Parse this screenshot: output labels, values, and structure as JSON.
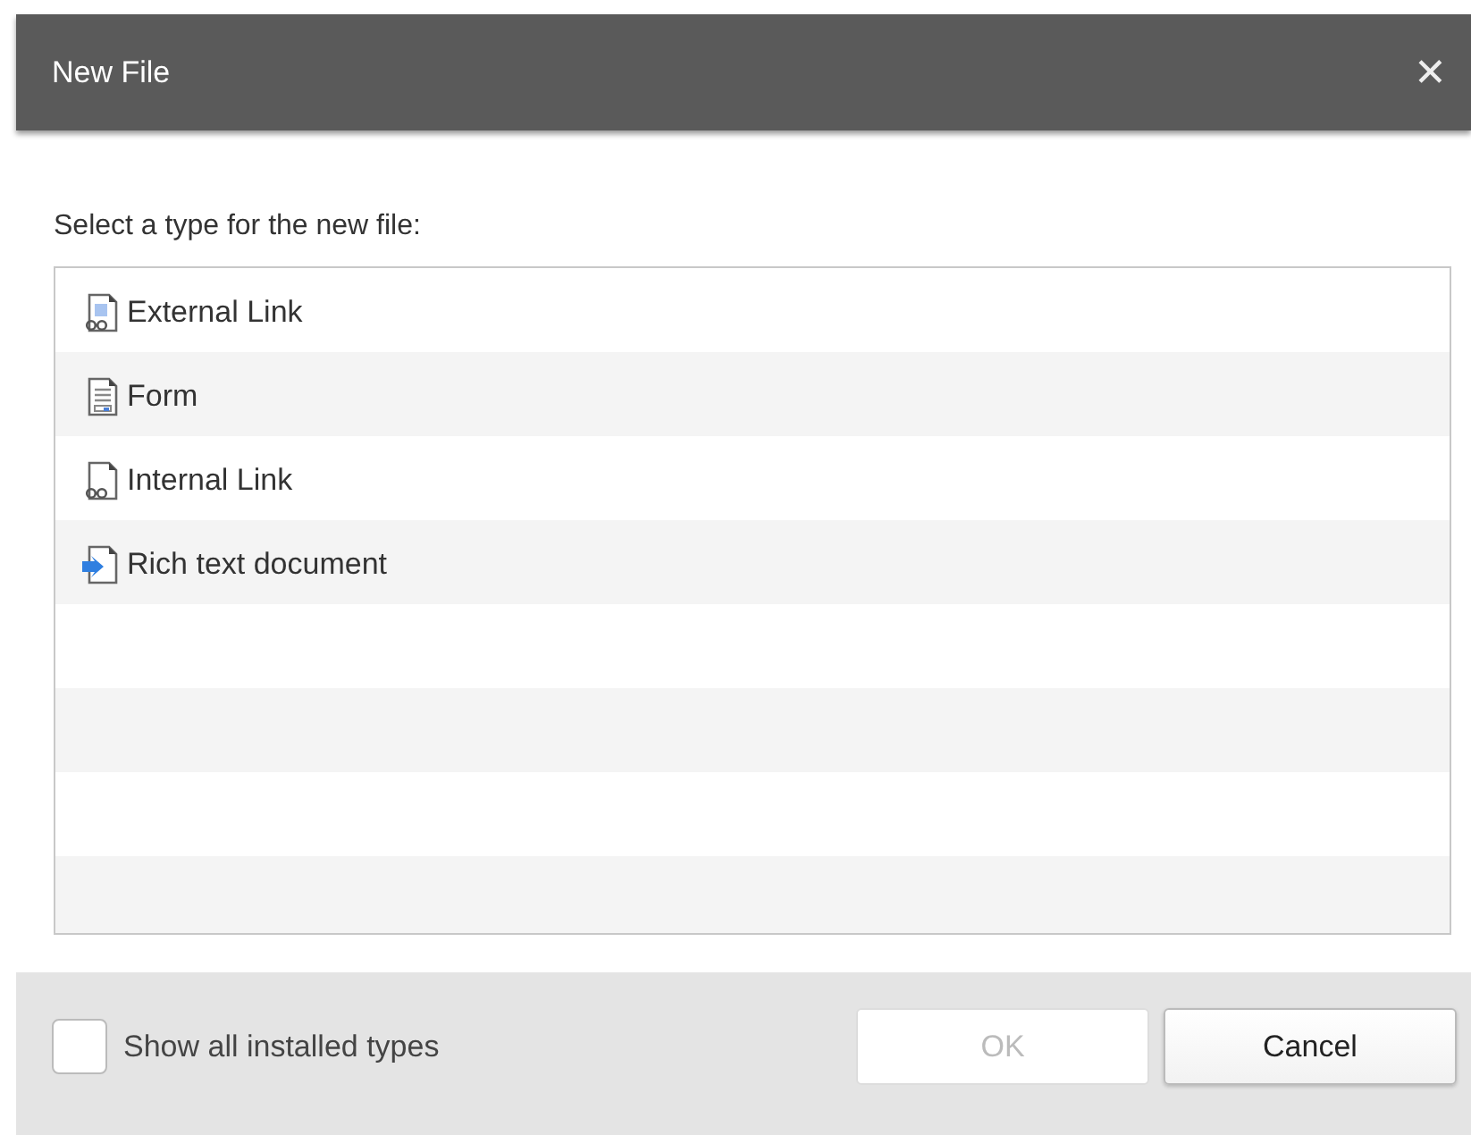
{
  "window": {
    "title": "New File",
    "close": "✕"
  },
  "prompt": "Select a type for the new file:",
  "types": [
    {
      "label": "External Link",
      "kind": "external-link",
      "selected": false
    },
    {
      "label": "Form",
      "kind": "form",
      "selected": false
    },
    {
      "label": "Internal Link",
      "kind": "internal-link",
      "selected": false
    },
    {
      "label": "Rich text document",
      "kind": "rich-text",
      "selected": false
    }
  ],
  "show_all": {
    "label": "Show all installed types",
    "checked": false
  },
  "buttons": [
    {
      "label": "OK",
      "disabled": true
    },
    {
      "label": "Cancel",
      "disabled": false
    }
  ]
}
